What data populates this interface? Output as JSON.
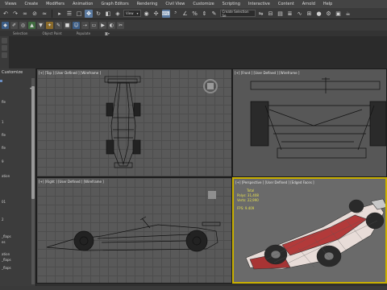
{
  "menu": {
    "items": [
      "Views",
      "Create",
      "Modifiers",
      "Animation",
      "Graph Editors",
      "Rendering",
      "Civil View",
      "Customize",
      "Scripting",
      "Interactive",
      "Content",
      "Arnold",
      "Help"
    ]
  },
  "toolbar": {
    "view_dropdown": "View",
    "selection_set_placeholder": "Create Selection Se"
  },
  "ribbon": {
    "tabs": [
      "Selection",
      "Object Paint",
      "Populate"
    ]
  },
  "command_panel": {
    "title": "Customize",
    "items": [
      "fle",
      "fle",
      "fle",
      "ation",
      "_flaps",
      "es",
      "ation",
      "_flaps",
      "_flaps"
    ],
    "numbers": [
      "1",
      "9",
      "01",
      "2"
    ]
  },
  "viewports": {
    "top": {
      "label": "[+] [Top ] [User Defined ] [Wireframe ]"
    },
    "front": {
      "label": "[+] [Front ] [User Defined ] [Wireframe ]"
    },
    "right": {
      "label": "[+] [Right ] [User Defined ] [Wireframe ]"
    },
    "perspective": {
      "label": "[+] [Perspective ] [User Defined ] [Edged Faces ]",
      "stats_title": "Total",
      "polys_label": "Polys:",
      "polys_value": "31,408",
      "verts_label": "Verts:",
      "verts_value": "22,990",
      "fps_label": "FPS:",
      "fps_value": "9.409"
    }
  },
  "colors": {
    "accent": "#5b7aa0",
    "active_viewport_border": "#c9b000",
    "stats_text": "#e6e050"
  }
}
